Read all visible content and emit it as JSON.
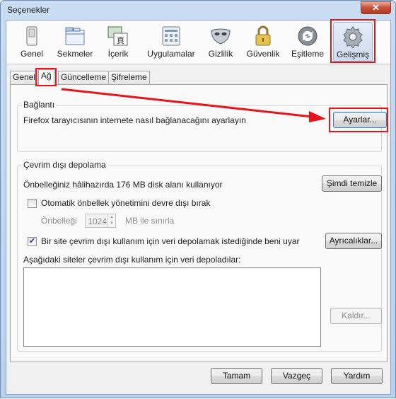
{
  "window": {
    "title": "Seçenekler",
    "close_label": "✕"
  },
  "toolbar": {
    "items": [
      {
        "label": "Genel",
        "icon": "general-switch-icon"
      },
      {
        "label": "Sekmeler",
        "icon": "tabs-icon"
      },
      {
        "label": "İçerik",
        "icon": "content-icon"
      },
      {
        "label": "Uygulamalar",
        "icon": "applications-icon"
      },
      {
        "label": "Gizlilik",
        "icon": "privacy-mask-icon"
      },
      {
        "label": "Güvenlik",
        "icon": "security-lock-icon"
      },
      {
        "label": "Eşitleme",
        "icon": "sync-icon"
      },
      {
        "label": "Gelişmiş",
        "icon": "advanced-gear-icon",
        "selected": true
      }
    ]
  },
  "subtabs": {
    "items": [
      {
        "label": "Genel"
      },
      {
        "label": "Ağ",
        "selected": true
      },
      {
        "label": "Güncelleme"
      },
      {
        "label": "Şifreleme"
      }
    ]
  },
  "connection": {
    "title": "Bağlantı",
    "description": "Firefox tarayıcısının internete nasıl bağlanacağını ayarlayın",
    "settings_button": "Ayarlar..."
  },
  "offline": {
    "title": "Çevrim dışı depolama",
    "usage_text": "Önbelleğiniz hâlihazırda 176 MB disk alanı kullanıyor",
    "clear_button": "Şimdi temizle",
    "override_checkbox_label": "Otomatik önbellek yönetimini devre dışı bırak",
    "override_checked": false,
    "limit_label": "Önbelleği",
    "limit_value": "1024",
    "limit_unit": "MB ile sınırla",
    "notify_checkbox_label": "Bir site çevrim dışı kullanım için veri depolamak istediğinde beni uyar",
    "notify_checked": true,
    "exceptions_button": "Ayrıcalıklar...",
    "list_label": "Aşağıdaki siteler çevrim dışı kullanım için veri depoladılar:",
    "remove_button": "Kaldır..."
  },
  "footer": {
    "ok_button": "Tamam",
    "cancel_button": "Vazgeç",
    "help_button": "Yardım"
  },
  "colors": {
    "highlight": "#e8141b",
    "accent": "#3c7fb1"
  }
}
